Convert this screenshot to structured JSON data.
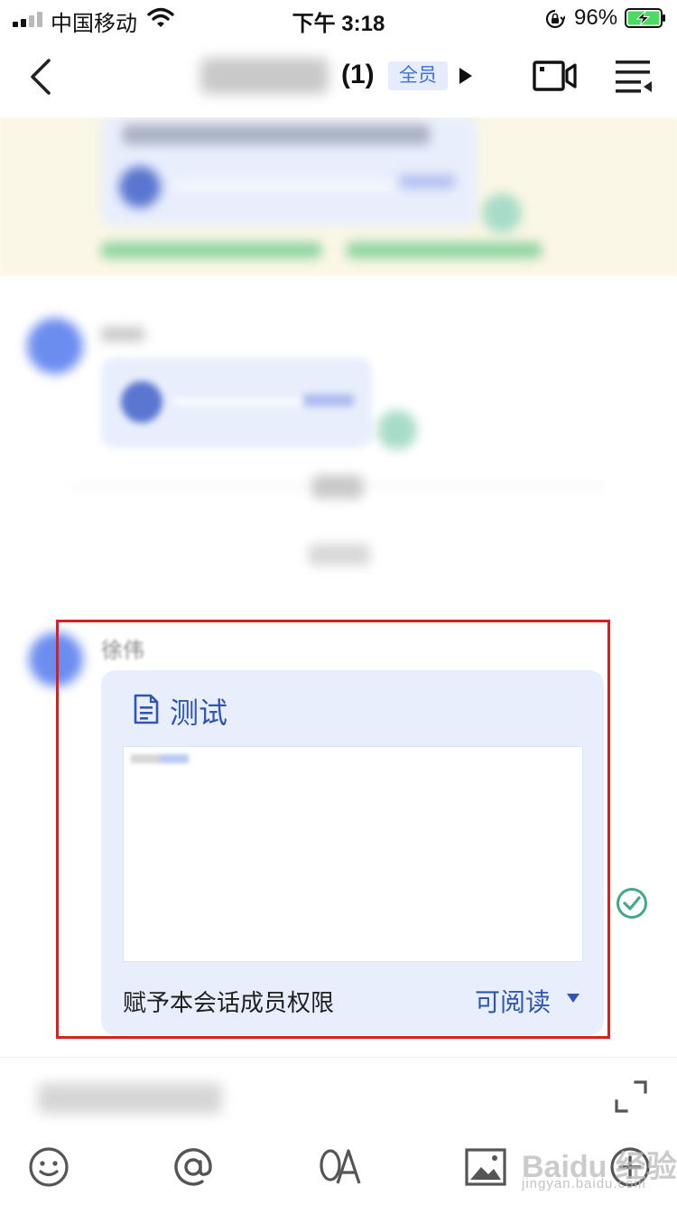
{
  "status_bar": {
    "carrier": "中国移动",
    "time": "下午 3:18",
    "battery_percent": "96%",
    "battery_level": 0.96,
    "icons": [
      "signal-icon",
      "wifi-icon",
      "rotation-lock-icon",
      "battery-charging-icon"
    ]
  },
  "nav": {
    "member_count": "(1)",
    "badge": "全员",
    "icons": [
      "back-arrow-icon",
      "play-triangle-icon",
      "video-call-icon",
      "menu-list-icon"
    ]
  },
  "message": {
    "doc_title": "测试",
    "permission_label": "赋予本会话成员权限",
    "permission_value": "可阅读"
  },
  "toolbar": {
    "icons": [
      "emoji-icon",
      "at-mention-icon",
      "oa-icon",
      "image-icon",
      "plus-icon"
    ]
  },
  "watermark": {
    "brand": "Baidu 经验",
    "url": "jingyan.baidu.com"
  },
  "colors": {
    "accent": "#2f56b0",
    "badge_bg": "#e6ecfb",
    "card_bg": "#e8eefc",
    "highlight_border": "#d92020",
    "read_check": "#3fa88f",
    "notice_bg": "#fbf7e6"
  }
}
